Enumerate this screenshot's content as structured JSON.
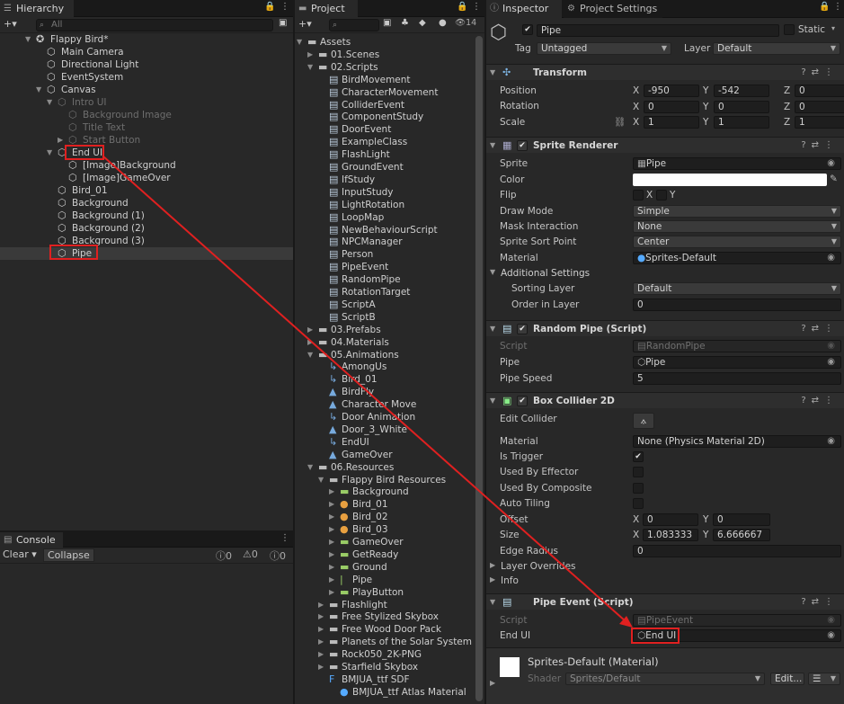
{
  "hierarchy": {
    "tab": "Hierarchy",
    "search_placeholder": "All",
    "scene": "Flappy Bird*",
    "items": [
      {
        "label": "Main Camera",
        "depth": 1
      },
      {
        "label": "Directional Light",
        "depth": 1
      },
      {
        "label": "EventSystem",
        "depth": 1
      },
      {
        "label": "Canvas",
        "depth": 1
      },
      {
        "label": "Intro UI",
        "depth": 2
      },
      {
        "label": "Background Image",
        "depth": 3
      },
      {
        "label": "Title Text",
        "depth": 3
      },
      {
        "label": "Start Button",
        "depth": 3
      },
      {
        "label": "End UI",
        "depth": 2
      },
      {
        "label": "[Image]Background",
        "depth": 3
      },
      {
        "label": "[Image]GameOver",
        "depth": 3
      },
      {
        "label": "Bird_01",
        "depth": 2
      },
      {
        "label": "Background",
        "depth": 2
      },
      {
        "label": "Background (1)",
        "depth": 2
      },
      {
        "label": "Background (2)",
        "depth": 2
      },
      {
        "label": "Background (3)",
        "depth": 2
      },
      {
        "label": "Pipe",
        "depth": 2
      }
    ]
  },
  "console": {
    "tab": "Console",
    "clear": "Clear",
    "collapse": "Collapse",
    "log_count": "0",
    "warn_count": "0",
    "error_count": "0"
  },
  "project": {
    "tab": "Project",
    "hidden_count": "14",
    "items": [
      {
        "label": "Assets"
      },
      {
        "label": "01.Scenes"
      },
      {
        "label": "02.Scripts"
      },
      {
        "label": "BirdMovement"
      },
      {
        "label": "CharacterMovement"
      },
      {
        "label": "ColliderEvent"
      },
      {
        "label": "ComponentStudy"
      },
      {
        "label": "DoorEvent"
      },
      {
        "label": "ExampleClass"
      },
      {
        "label": "FlashLight"
      },
      {
        "label": "GroundEvent"
      },
      {
        "label": "IfStudy"
      },
      {
        "label": "InputStudy"
      },
      {
        "label": "LightRotation"
      },
      {
        "label": "LoopMap"
      },
      {
        "label": "NewBehaviourScript"
      },
      {
        "label": "NPCManager"
      },
      {
        "label": "Person"
      },
      {
        "label": "PipeEvent"
      },
      {
        "label": "RandomPipe"
      },
      {
        "label": "RotationTarget"
      },
      {
        "label": "ScriptA"
      },
      {
        "label": "ScriptB"
      },
      {
        "label": "03.Prefabs"
      },
      {
        "label": "04.Materials"
      },
      {
        "label": "05.Animations"
      },
      {
        "label": "AmongUs"
      },
      {
        "label": "Bird_01"
      },
      {
        "label": "BirdFly"
      },
      {
        "label": "Character Move"
      },
      {
        "label": "Door Animation"
      },
      {
        "label": "Door_3_White"
      },
      {
        "label": "EndUI"
      },
      {
        "label": "GameOver"
      },
      {
        "label": "06.Resources"
      },
      {
        "label": "Flappy Bird Resources"
      },
      {
        "label": "Background"
      },
      {
        "label": "Bird_01"
      },
      {
        "label": "Bird_02"
      },
      {
        "label": "Bird_03"
      },
      {
        "label": "GameOver"
      },
      {
        "label": "GetReady"
      },
      {
        "label": "Ground"
      },
      {
        "label": "Pipe"
      },
      {
        "label": "PlayButton"
      },
      {
        "label": "Flashlight"
      },
      {
        "label": "Free Stylized Skybox"
      },
      {
        "label": "Free Wood Door Pack"
      },
      {
        "label": "Planets of the Solar System 3"
      },
      {
        "label": "Rock050_2K-PNG"
      },
      {
        "label": "Starfield Skybox"
      },
      {
        "label": "BMJUA_ttf SDF"
      },
      {
        "label": "BMJUA_ttf Atlas Material"
      }
    ]
  },
  "inspector": {
    "tab": "Inspector",
    "tab2": "Project Settings",
    "object_name": "Pipe",
    "static_label": "Static",
    "tag_label": "Tag",
    "tag_value": "Untagged",
    "layer_label": "Layer",
    "layer_value": "Default",
    "transform": {
      "title": "Transform",
      "position_label": "Position",
      "rotation_label": "Rotation",
      "scale_label": "Scale",
      "x": "X",
      "y": "Y",
      "z": "Z",
      "pos": [
        "-950",
        "-542",
        "0"
      ],
      "rot": [
        "0",
        "0",
        "0"
      ],
      "scale": [
        "1",
        "1",
        "1"
      ]
    },
    "sprite_renderer": {
      "title": "Sprite Renderer",
      "sprite_label": "Sprite",
      "sprite_value": "Pipe",
      "color_label": "Color",
      "flip_label": "Flip",
      "flip_x": "X",
      "flip_y": "Y",
      "draw_mode_label": "Draw Mode",
      "draw_mode_value": "Simple",
      "mask_label": "Mask Interaction",
      "mask_value": "None",
      "sort_point_label": "Sprite Sort Point",
      "sort_point_value": "Center",
      "material_label": "Material",
      "material_value": "Sprites-Default",
      "additional": "Additional Settings",
      "sorting_layer_label": "Sorting Layer",
      "sorting_layer_value": "Default",
      "order_label": "Order in Layer",
      "order_value": "0"
    },
    "random_pipe": {
      "title": "Random Pipe (Script)",
      "script_label": "Script",
      "script_value": "RandomPipe",
      "pipe_label": "Pipe",
      "pipe_value": "Pipe",
      "speed_label": "Pipe Speed",
      "speed_value": "5"
    },
    "box_collider": {
      "title": "Box Collider 2D",
      "edit_label": "Edit Collider",
      "material_label": "Material",
      "material_value": "None (Physics Material 2D)",
      "trigger_label": "Is Trigger",
      "effector_label": "Used By Effector",
      "composite_label": "Used By Composite",
      "tiling_label": "Auto Tiling",
      "offset_label": "Offset",
      "offset": [
        "0",
        "0"
      ],
      "size_label": "Size",
      "size": [
        "1.083333",
        "6.666667"
      ],
      "edge_label": "Edge Radius",
      "edge_value": "0",
      "layer_overrides": "Layer Overrides",
      "info": "Info"
    },
    "pipe_event": {
      "title": "Pipe Event (Script)",
      "script_label": "Script",
      "script_value": "PipeEvent",
      "endui_label": "End UI",
      "endui_value": "End UI"
    },
    "material": {
      "title": "Sprites-Default (Material)",
      "shader_label": "Shader",
      "shader_value": "Sprites/Default",
      "edit_button": "Edit..."
    }
  },
  "colors": {
    "highlight": "#e02020",
    "arrow": "#e02020",
    "panel": "#282828"
  }
}
